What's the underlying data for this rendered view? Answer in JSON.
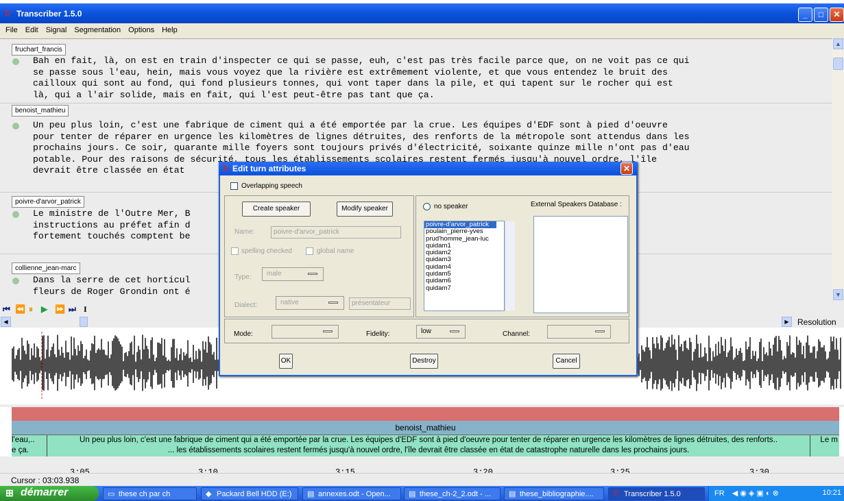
{
  "window": {
    "title": "Transcriber 1.5.0",
    "min": "_",
    "max": "□",
    "close": "✕"
  },
  "menu": [
    "File",
    "Edit",
    "Signal",
    "Segmentation",
    "Options",
    "Help"
  ],
  "turns": [
    {
      "speaker": "fruchart_francis",
      "lines": [
        "Bah en fait, là, on est en train d'inspecter ce qui se passe, euh, c'est pas très facile parce que, on ne voit pas ce qui",
        "se passe sous l'eau, hein, mais vous voyez que la rivière est extrêmement violente, et que vous entendez le bruit des",
        "cailloux qui sont au fond, qui fond plusieurs tonnes, qui vont taper dans la pile, et qui tapent sur le rocher qui est",
        "là, qui a l'air solide, mais en fait, qui l'est peut-être pas tant que ça."
      ]
    },
    {
      "speaker": "benoist_mathieu",
      "lines": [
        "Un peu plus loin, c'est une fabrique de ciment qui a été emportée par la crue. Les équipes d'EDF sont à pied d'oeuvre",
        "pour tenter de réparer en urgence les kilomètres de lignes détruites, des renforts de la métropole sont attendus dans les",
        "prochains jours. Ce soir, quarante mille foyers sont toujours privés d'électricité, soixante quinze mille n'ont pas d'eau",
        "potable. Pour des raisons de sécurité, tous les établissements scolaires restent fermés jusqu'à nouvel ordre, l'île",
        "devrait être classée en état"
      ]
    },
    {
      "speaker": "poivre-d'arvor_patrick",
      "lines": [
        "Le ministre de l'Outre Mer, B                                     avait donc donné des",
        "instructions au préfet afin d                                    iculteurs et les éleveurs",
        "fortement touchés comptent be                                    ienne."
      ]
    },
    {
      "speaker": "collienne_jean-marc",
      "lines": [
        "Dans la serre de cet horticul                                    yclone. Les deux hectares de",
        "fleurs de Roger Grondin ont é"
      ]
    }
  ],
  "toolbar": {
    "buttons": [
      "⏮",
      "⏪",
      "⏸",
      "▶",
      "⏩",
      "⏭"
    ],
    "cursor_tool": "I"
  },
  "resolution_label": "Resolution",
  "segments": {
    "speaker_segment": "benoist_mathieu",
    "left_text": "l'eau,..\ne ça.",
    "main_text": "Un peu plus loin, c'est une fabrique de ciment qui a été emportée par la crue. Les équipes d'EDF sont à pied d'oeuvre pour tenter de réparer en urgence les kilomètres de lignes détruites, des renforts..\n... les établissements scolaires restent fermés jusqu'à nouvel ordre, l'île devrait être classée en état de catastrophe naturelle dans les prochains jours.",
    "right_text": "Le m"
  },
  "timeline": [
    "3:05",
    "3:10",
    "3:15",
    "3:20",
    "3:25",
    "3:30"
  ],
  "cursor": "Cursor : 03:03.938",
  "dialog": {
    "title": "Edit turn attributes",
    "overlapping": "Overlapping speech",
    "create_speaker": "Create speaker",
    "modify_speaker": "Modify speaker",
    "name_label": "Name:",
    "name_value": "poivre-d'arvor_patrick",
    "spelling_checked": "spelling checked",
    "global_name": "global name",
    "type_label": "Type:",
    "type_value": "male",
    "dialect_label": "Dialect:",
    "dialect_value": "native",
    "accent_value": "présentateur",
    "no_speaker": "no speaker",
    "speakers": [
      "poivre-d'arvor_patrick",
      "poulain_pierre-yves",
      "prud'homme_jean-luc",
      "quidam1",
      "quidam2",
      "quidam3",
      "quidam4",
      "quidam5",
      "quidam6",
      "quidam7"
    ],
    "selected_speaker": "poivre-d'arvor_patrick",
    "external_db": "External Speakers Database :",
    "mode_label": "Mode:",
    "fidelity_label": "Fidelity:",
    "fidelity_value": "low",
    "channel_label": "Channel:",
    "ok": "OK",
    "destroy": "Destroy",
    "cancel": "Cancel"
  },
  "taskbar": {
    "start": "démarrer",
    "tasks": [
      "these ch par ch",
      "Packard Bell HDD (E:)",
      "annexes.odt - Open...",
      "these_ch-2_2.odt - ...",
      "these_bibliographie....",
      "Transcriber 1.5.0"
    ],
    "lang": "FR",
    "clock": "10:21"
  }
}
